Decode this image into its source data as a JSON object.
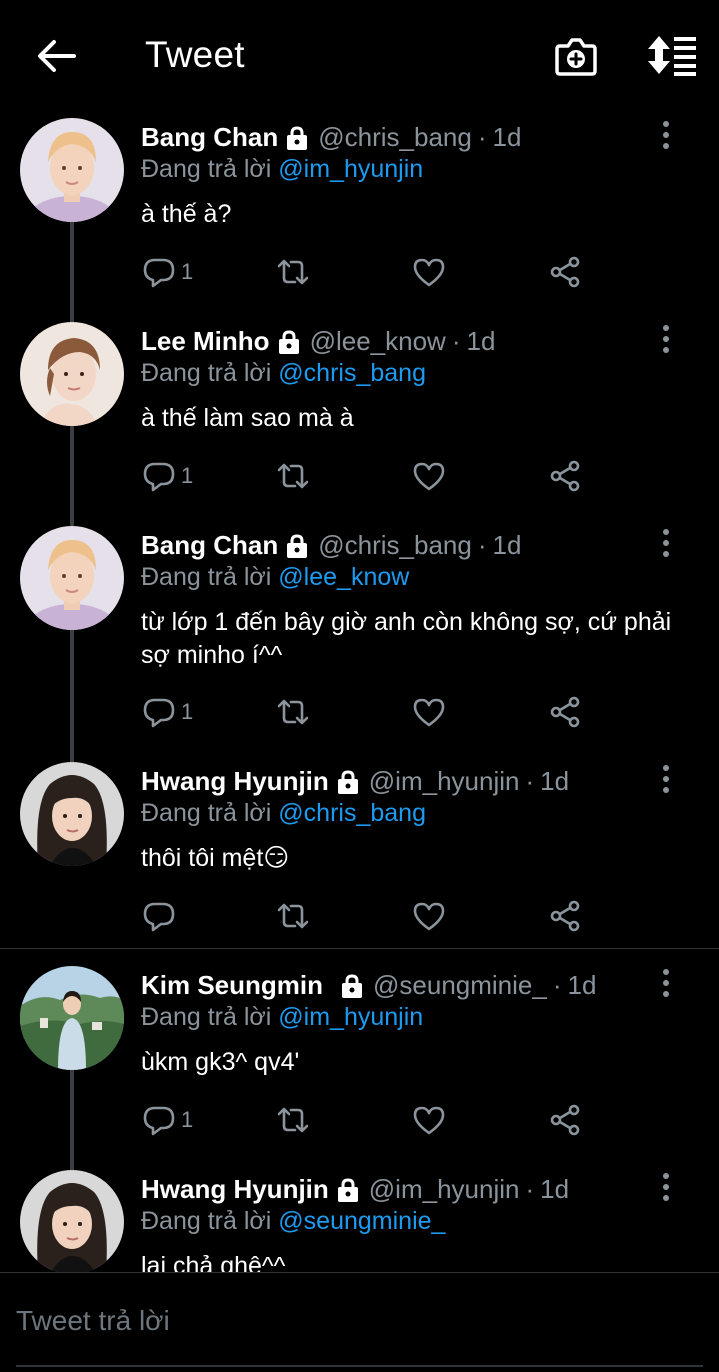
{
  "header": {
    "title": "Tweet",
    "back_icon": "arrow-left-icon",
    "camera_icon": "camera-plus-icon",
    "sort_icon": "sort-list-icon"
  },
  "colors": {
    "background": "#000000",
    "mention": "#1d9bf0",
    "muted": "#8b949c",
    "thread_line": "#3a3d42"
  },
  "replying_label": "Đang trả lời",
  "tweets": [
    {
      "name": "Bang Chan",
      "handle": "@chris_bang",
      "time": "1d",
      "reply_to": "@im_hyunjin",
      "text": "à thế à?",
      "reply_count": "1"
    },
    {
      "name": "Lee Minho",
      "handle": "@lee_know",
      "time": "1d",
      "reply_to": "@chris_bang",
      "text": "à thế làm sao mà à",
      "reply_count": "1"
    },
    {
      "name": "Bang Chan",
      "handle": "@chris_bang",
      "time": "1d",
      "reply_to": "@lee_know",
      "text": "từ lớp 1 đến bây giờ anh còn không sợ, cứ phải sợ minho í^^",
      "reply_count": "1"
    },
    {
      "name": "Hwang Hyunjin",
      "handle": "@im_hyunjin",
      "time": "1d",
      "reply_to": "@chris_bang",
      "text": "thôi tôi mệt😏",
      "reply_count": ""
    },
    {
      "name": "Kim Seungmin",
      "handle": "@seungminie_",
      "time": "1d",
      "reply_to": "@im_hyunjin",
      "text": "ùkm gk3^ qv4'",
      "reply_count": "1"
    },
    {
      "name": "Hwang Hyunjin",
      "handle": "@im_hyunjin",
      "time": "1d",
      "reply_to": "@seungminie_",
      "text": "lại chả ghê^^",
      "reply_count": ""
    }
  ],
  "compose": {
    "placeholder": "Tweet trả lời"
  }
}
